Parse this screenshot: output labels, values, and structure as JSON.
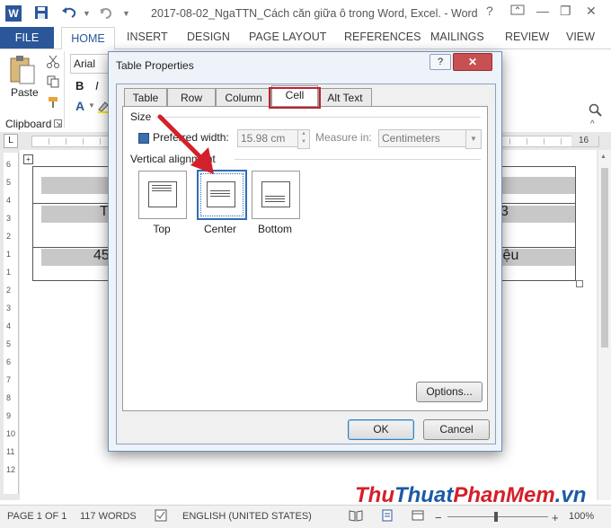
{
  "titlebar": {
    "doc_title": "2017-08-02_NgaTTN_Cách căn giữa ô trong Word, Excel. - Word",
    "word_icon": "W",
    "help": "?",
    "minimize": "—",
    "restore": "❐",
    "close": "✕"
  },
  "ribbon_tabs": [
    "FILE",
    "HOME",
    "INSERT",
    "DESIGN",
    "PAGE LAYOUT",
    "REFERENCES",
    "MAILINGS",
    "REVIEW",
    "VIEW"
  ],
  "ribbon": {
    "font_name": "Arial",
    "paste_label": "Paste",
    "clipboard_label": "Clipboard",
    "bold": "B",
    "italic": "I"
  },
  "ruler": {
    "left_mark": "L",
    "right_mark": "16"
  },
  "vertical_ruler": [
    "6",
    "5",
    "4",
    "3",
    "2",
    "1",
    "1",
    "2",
    "3",
    "4",
    "5",
    "6",
    "7",
    "8",
    "9",
    "10",
    "11",
    "12"
  ],
  "document_table": {
    "row2_left": "T",
    "row2_right": "3",
    "row3_left": "45",
    "row3_right": "iệu"
  },
  "dialog": {
    "title": "Table Properties",
    "help_button": "?",
    "close_button": "✕",
    "tabs": [
      "Table",
      "Row",
      "Column",
      "Cell",
      "Alt Text"
    ],
    "selected_tab": "Cell",
    "size_section": "Size",
    "preferred_width_label": "Preferred width:",
    "preferred_width_value": "15.98 cm",
    "measure_in_label": "Measure in:",
    "measure_in_value": "Centimeters",
    "vertical_alignment_label": "Vertical alignment",
    "align_options": [
      "Top",
      "Center",
      "Bottom"
    ],
    "selected_alignment": "Center",
    "options_button": "Options...",
    "ok_button": "OK",
    "cancel_button": "Cancel"
  },
  "status_bar": {
    "page": "PAGE 1 OF 1",
    "words": "117 WORDS",
    "language": "ENGLISH (UNITED STATES)",
    "zoom": "100%",
    "zoom_minus": "−",
    "zoom_plus": "+"
  },
  "watermark": {
    "part1": "Thu",
    "part2": "Thuat",
    "part3": "PhanMem",
    "part4": ".vn"
  },
  "colors": {
    "word_blue": "#2b579a",
    "dialog_border": "#6d8dbf",
    "highlight_red": "#c0202c",
    "watermark_red": "#d4202a",
    "watermark_blue": "#1c5aa8"
  }
}
